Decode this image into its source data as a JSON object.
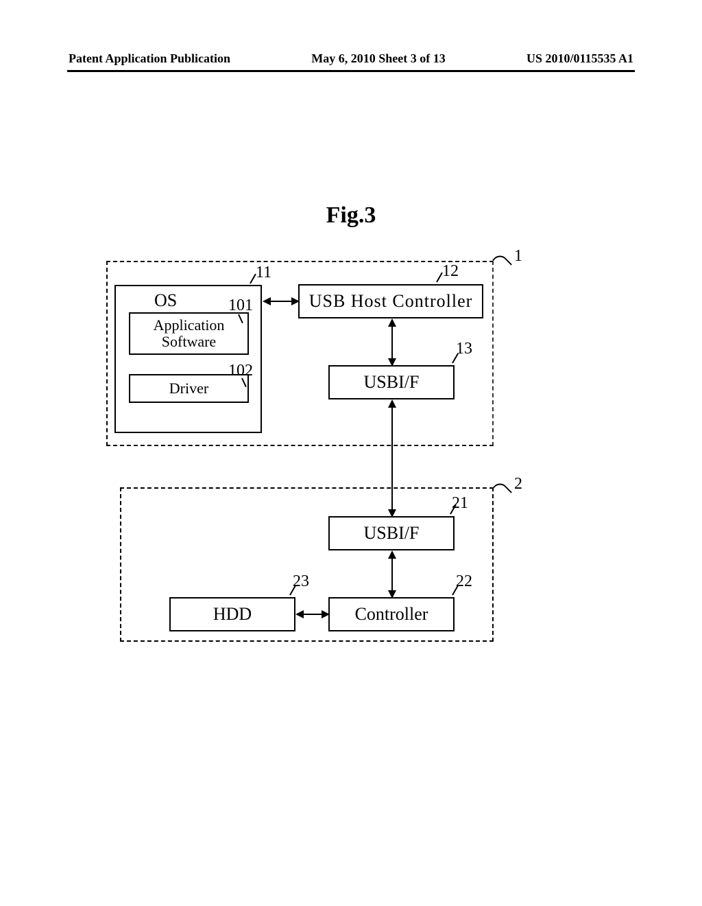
{
  "header": {
    "left": "Patent Application Publication",
    "center": "May 6, 2010  Sheet 3 of 13",
    "right": "US 2010/0115535 A1"
  },
  "figure": {
    "title": "Fig.3"
  },
  "blocks": {
    "os": "OS",
    "app_software": "Application\nSoftware",
    "driver": "Driver",
    "usb_host": "USB  Host  Controller",
    "usbif1": "USBI/F",
    "usbif2": "USBI/F",
    "hdd": "HDD",
    "controller": "Controller"
  },
  "refs": {
    "r1": "1",
    "r11": "11",
    "r12": "12",
    "r101": "101",
    "r102": "102",
    "r13": "13",
    "r2": "2",
    "r21": "21",
    "r22": "22",
    "r23": "23"
  }
}
